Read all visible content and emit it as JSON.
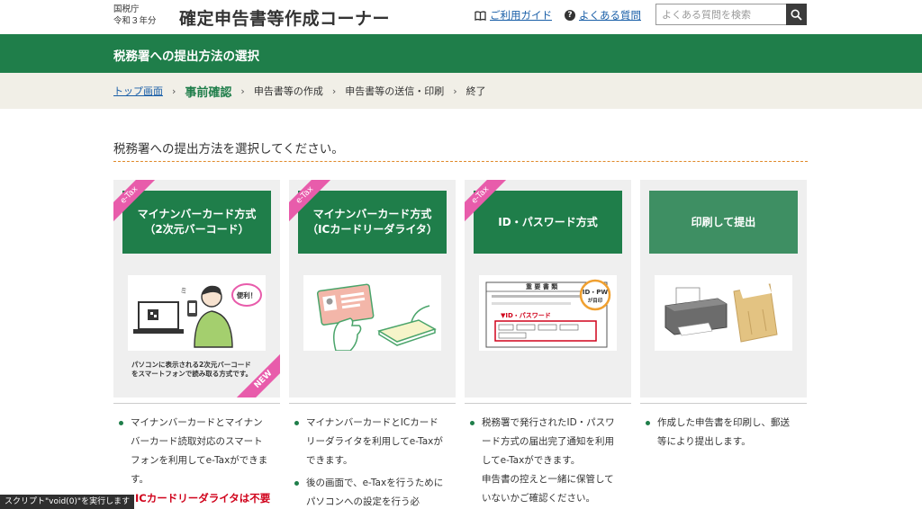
{
  "header": {
    "agency": "国税庁",
    "year": "令和３年分",
    "title": "確定申告書等作成コーナー",
    "guide_link": "ご利用ガイド",
    "faq_link": "よくある質問",
    "search_placeholder": "よくある質問を検索"
  },
  "band": {
    "title": "税務署への提出方法の選択"
  },
  "breadcrumb": [
    "トップ画面",
    "事前確認",
    "申告書等の作成",
    "申告書等の送信・印刷",
    "終了"
  ],
  "instruction": "税務署への提出方法を選択してください。",
  "cards": [
    {
      "ribbon": "e-Tax",
      "title_line1": "マイナンバーカード方式",
      "title_line2": "（2次元バーコード）",
      "caption_line1": "パソコンに表示される2次元バーコード",
      "caption_line2": "をスマートフォンで読み取る方式です。",
      "badge": "NEW",
      "bubble": "便利！"
    },
    {
      "ribbon": "e-Tax",
      "title_line1": "マイナンバーカード方式",
      "title_line2": "（ICカードリーダライタ）"
    },
    {
      "ribbon": "e-Tax",
      "title_line1": "ID・パスワード方式",
      "doc_title": "重 要 書 類",
      "stamp_line1": "ID・PW",
      "stamp_line2": "が目印",
      "doc_label": "▼ID・パスワード"
    },
    {
      "title_line1": "印刷して提出"
    }
  ],
  "descriptions": [
    {
      "items": [
        "マイナンバーカードとマイナンバーカード読取対応のスマートフォンを利用してe-Taxができます。"
      ]
    },
    {
      "items": [
        "マイナンバーカードとICカードリーダライタを利用してe-Taxができます。",
        "後の画面で、e-Taxを行うためにパソコンへの設定を行う必"
      ]
    },
    {
      "items": [
        "税務署で発行されたID・パスワード方式の届出完了通知を利用してe-Taxができます。"
      ],
      "note": "申告書の控えと一緒に保管していないかご確認ください。"
    },
    {
      "items": [
        "作成した申告書を印刷し、郵送等により提出します。"
      ]
    }
  ],
  "warning": "ICカードリーダライタは不要",
  "status_tip": "スクリプト\"void(0)\"を実行します",
  "colors": {
    "brand_green": "#1f7e4a",
    "ribbon_pink": "#e85cab",
    "link_blue": "#1a5fa8",
    "warning_red": "#d0021b"
  }
}
